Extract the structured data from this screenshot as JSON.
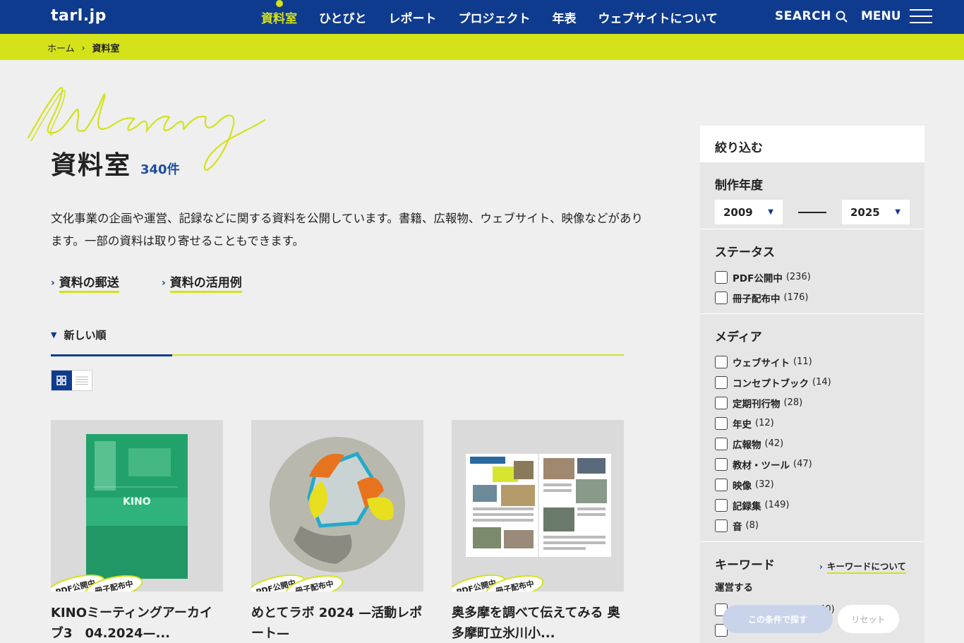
{
  "header": {
    "logo": "tarl.jp",
    "nav": [
      "資料室",
      "ひとびと",
      "レポート",
      "プロジェクト",
      "年表",
      "ウェブサイトについて"
    ],
    "search_label": "SEARCH",
    "menu_label": "MENU"
  },
  "breadcrumb": {
    "home": "ホーム",
    "sep": "›",
    "current": "資料室"
  },
  "main": {
    "title": "資料室",
    "count": "340件",
    "intro": "文化事業の企画や運営、記録などに関する資料を公開しています。書籍、広報物、ウェブサイト、映像などがあります。一部の資料は取り寄せることもできます。",
    "links": [
      "資料の郵送",
      "資料の活用例"
    ],
    "sort_label": "新しい順"
  },
  "cards": [
    {
      "title": "KINOミーティングアーカイブ3　04.2024—...",
      "badges": [
        "PDF公開中",
        "冊子配布中"
      ],
      "thumb_text": "KINO"
    },
    {
      "title": "めとてラボ 2024 —活動レポート—",
      "badges": [
        "PDF公開中",
        "冊子配布中"
      ]
    },
    {
      "title": "奥多摩を調べて伝えてみる 奥多摩町立氷川小...",
      "badges": [
        "PDF公開中",
        "冊子配布中"
      ]
    }
  ],
  "filters": {
    "header": "絞り込む",
    "year_title": "制作年度",
    "year_from": "2009",
    "year_to": "2025",
    "status_title": "ステータス",
    "status": [
      {
        "label": "PDF公開中",
        "count": "(236)"
      },
      {
        "label": "冊子配布中",
        "count": "(176)"
      }
    ],
    "media_title": "メディア",
    "media": [
      {
        "label": "ウェブサイト",
        "count": "(11)"
      },
      {
        "label": "コンセプトブック",
        "count": "(14)"
      },
      {
        "label": "定期刊行物",
        "count": "(28)"
      },
      {
        "label": "年史",
        "count": "(12)"
      },
      {
        "label": "広報物",
        "count": "(42)"
      },
      {
        "label": "教材・ツール",
        "count": "(47)"
      },
      {
        "label": "映像",
        "count": "(32)"
      },
      {
        "label": "記録集",
        "count": "(149)"
      },
      {
        "label": "音",
        "count": "(8)"
      }
    ],
    "keyword_title": "キーワード",
    "keyword_link": "キーワードについて",
    "keyword_sub": "運営する",
    "keyword_partial_count": "(40)",
    "search_button": "この条件で探す",
    "reset_button": "リセット"
  },
  "colors": {
    "navy": "#0f3b8f",
    "lime": "#d4e21a",
    "count_blue": "#1d4ea0"
  }
}
